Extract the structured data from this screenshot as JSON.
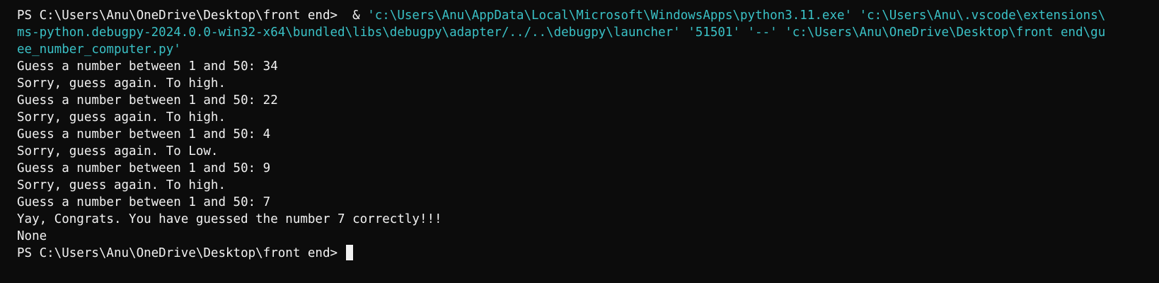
{
  "prompt": {
    "text": "PS C:\\Users\\Anu\\OneDrive\\Desktop\\front end>",
    "ampersand": "&"
  },
  "command": {
    "line1_args": "'c:\\Users\\Anu\\AppData\\Local\\Microsoft\\WindowsApps\\python3.11.exe' 'c:\\Users\\Anu\\.vscode\\extensions\\",
    "line2": "ms-python.debugpy-2024.0.0-win32-x64\\bundled\\libs\\debugpy\\adapter/../..\\debugpy\\launcher' '51501' '--' 'c:\\Users\\Anu\\OneDrive\\Desktop\\front end\\gu",
    "line3": "ee_number_computer.py'"
  },
  "output": [
    "Guess a number between 1 and 50: 34",
    "Sorry, guess again. To high.",
    "Guess a number between 1 and 50: 22",
    "Sorry, guess again. To high.",
    "Guess a number between 1 and 50: 4",
    "Sorry, guess again. To Low.",
    "Guess a number between 1 and 50: 9",
    "Sorry, guess again. To high.",
    "Guess a number between 1 and 50: 7",
    "Yay, Congrats. You have guessed the number 7 correctly!!!",
    "None"
  ],
  "final_prompt": "PS C:\\Users\\Anu\\OneDrive\\Desktop\\front end>",
  "colors": {
    "background": "#0c0c0c",
    "foreground": "#f2f2f2",
    "string": "#3ac1c6"
  }
}
